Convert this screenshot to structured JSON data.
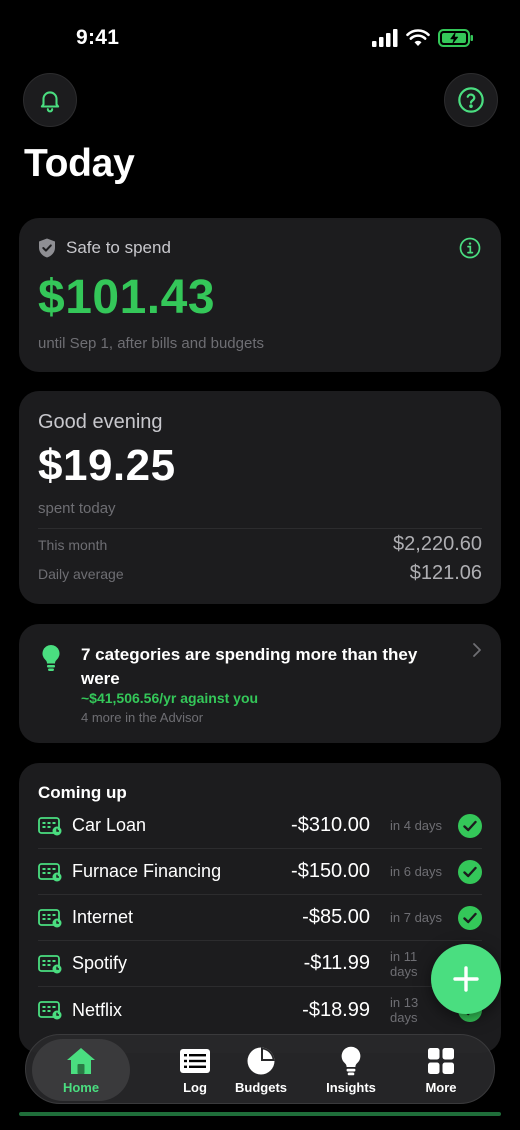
{
  "status_bar": {
    "time": "9:41"
  },
  "header": {
    "title": "Today"
  },
  "safe_to_spend": {
    "label": "Safe to spend",
    "amount": "$101.43",
    "subtitle": "until Sep 1, after bills and budgets"
  },
  "spending": {
    "greeting": "Good evening",
    "amount": "$19.25",
    "amount_label": "spent today",
    "this_month_label": "This month",
    "this_month_value": "$2,220.60",
    "daily_avg_label": "Daily average",
    "daily_avg_value": "$121.06"
  },
  "advisor": {
    "title": "7 categories are spending more than they were",
    "amount": "~$41,506.56/yr against you",
    "more": "4 more in the Advisor"
  },
  "coming_up": {
    "title": "Coming up",
    "bills": [
      {
        "name": "Car Loan",
        "amount": "-$310.00",
        "due": "in 4 days"
      },
      {
        "name": "Furnace Financing",
        "amount": "-$150.00",
        "due": "in 6 days"
      },
      {
        "name": "Internet",
        "amount": "-$85.00",
        "due": "in 7 days"
      },
      {
        "name": "Spotify",
        "amount": "-$11.99",
        "due": "in 11 days"
      },
      {
        "name": "Netflix",
        "amount": "-$18.99",
        "due": "in 13 days"
      }
    ]
  },
  "tabs": [
    {
      "label": "Home",
      "active": true
    },
    {
      "label": "Log"
    },
    {
      "label": "Budgets"
    },
    {
      "label": "Insights"
    },
    {
      "label": "More"
    }
  ],
  "colors": {
    "accent": "#34c759",
    "accent_light": "#4ade80",
    "card": "#1c1c1e",
    "background": "#000000"
  }
}
